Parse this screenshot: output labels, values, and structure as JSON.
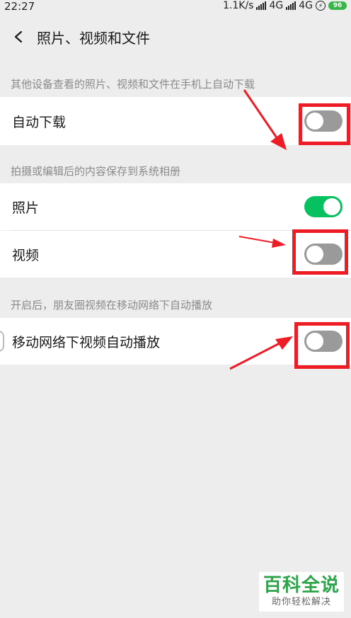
{
  "status": {
    "time": "22:27",
    "speed": "1.1K/s",
    "net1": "4G",
    "net2": "4G",
    "battery": "96"
  },
  "nav": {
    "title": "照片、视频和文件"
  },
  "sections": [
    {
      "label": "其他设备查看的照片、视频和文件在手机上自动下载"
    },
    {
      "label": "拍摄或编辑后的内容保存到系统相册"
    },
    {
      "label": "开启后，朋友圈视频在移动网络下自动播放"
    }
  ],
  "rows": {
    "auto_download": {
      "label": "自动下载",
      "on": false
    },
    "photos": {
      "label": "照片",
      "on": true
    },
    "videos": {
      "label": "视频",
      "on": false
    },
    "autoplay": {
      "label": "移动网络下视频自动播放",
      "on": false
    }
  },
  "colors": {
    "toggle_on": "#07c160",
    "toggle_off": "#9a9a9a",
    "annotation": "#ee1c24"
  },
  "watermark": {
    "main": "百科全说",
    "sub": "助你轻松解决"
  }
}
